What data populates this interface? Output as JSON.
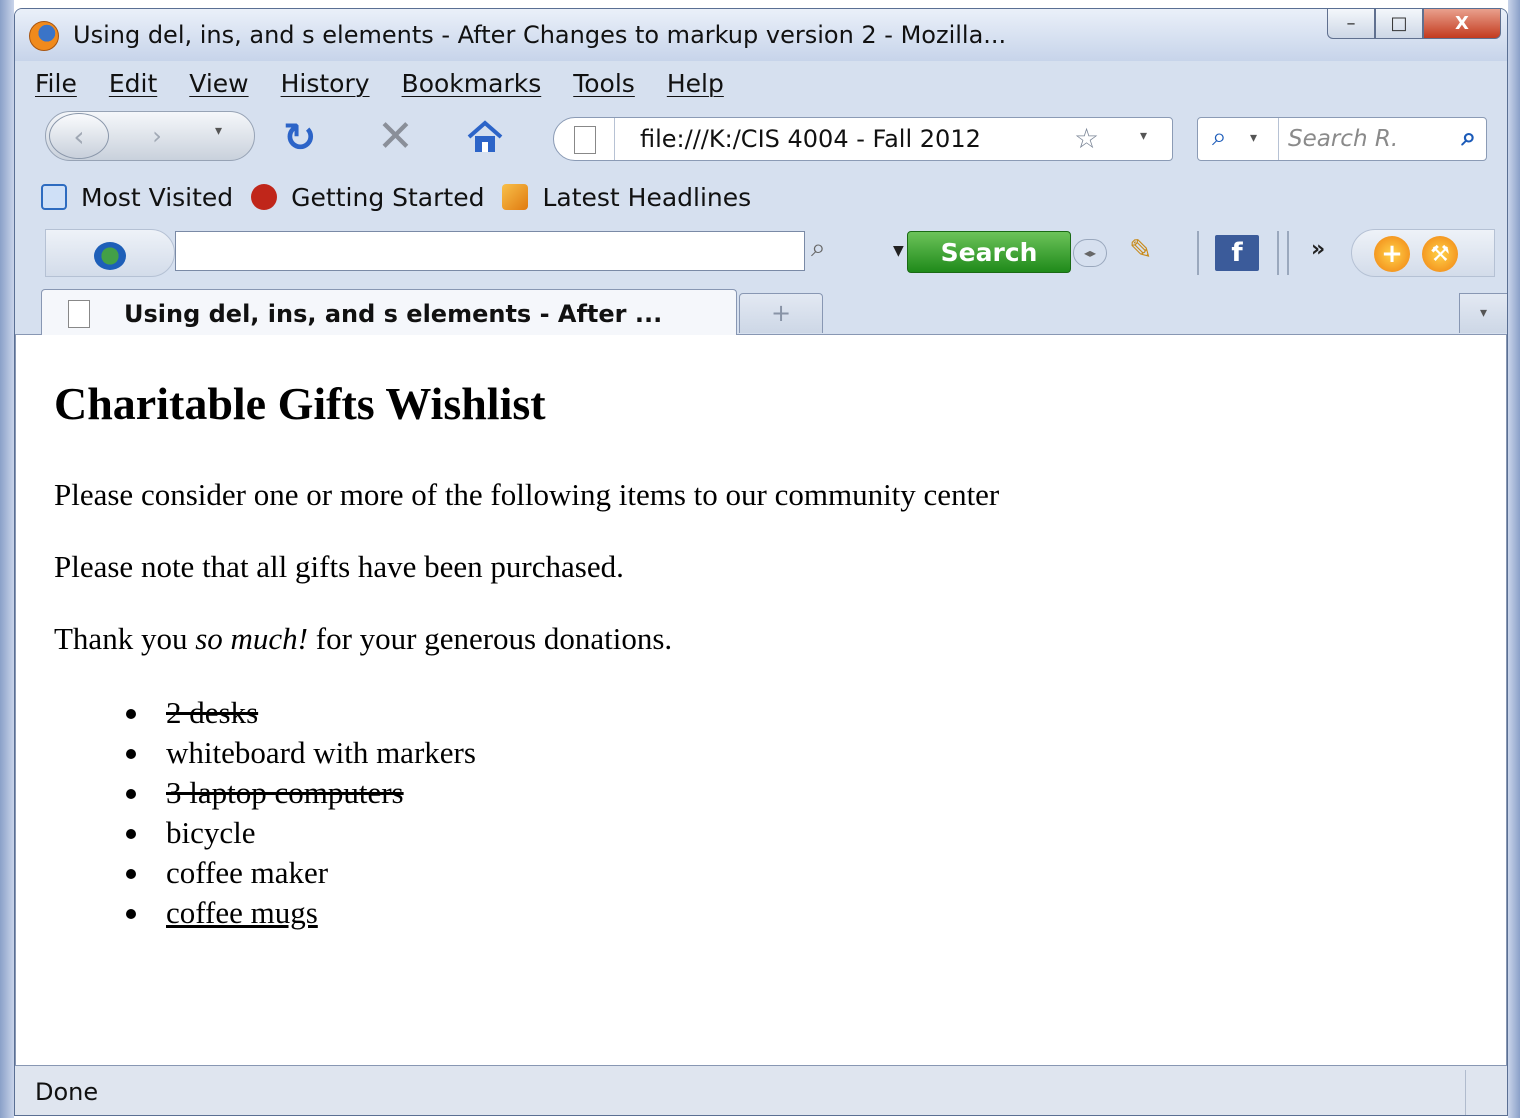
{
  "window": {
    "title": "Using del, ins, and s elements - After Changes to markup version 2 - Mozilla...",
    "min_glyph": "–",
    "max_glyph": "□",
    "close_glyph": "X"
  },
  "menu": [
    {
      "label": "File"
    },
    {
      "label": "Edit"
    },
    {
      "label": "View"
    },
    {
      "label": "History"
    },
    {
      "label": "Bookmarks"
    },
    {
      "label": "Tools"
    },
    {
      "label": "Help"
    }
  ],
  "nav": {
    "url": "file:///K:/CIS 4004 - Fall 2012",
    "search_placeholder": "Search R."
  },
  "bookmarks": [
    {
      "label": "Most Visited",
      "icon": "bookmark-folder-icon"
    },
    {
      "label": "Getting Started",
      "icon": "firefox-dino-icon"
    },
    {
      "label": "Latest Headlines",
      "icon": "rss-feed-icon"
    }
  ],
  "toolbar": {
    "search_button": "Search",
    "facebook_glyph": "f",
    "chevron": "»"
  },
  "tabs": [
    {
      "label": "Using del, ins, and s elements - After ..."
    }
  ],
  "page": {
    "heading": "Charitable Gifts Wishlist",
    "para1": "Please consider one or more of the following items to our community center",
    "para2": "Please note that all gifts have been purchased.",
    "para3_before": "Thank you ",
    "para3_em": "so much!",
    "para3_after": " for your generous donations.",
    "items": [
      {
        "text": "2 desks",
        "style": "deleted"
      },
      {
        "text": "whiteboard with markers",
        "style": "normal"
      },
      {
        "text": "3 laptop computers",
        "style": "deleted"
      },
      {
        "text": "bicycle",
        "style": "normal"
      },
      {
        "text": "coffee maker",
        "style": "normal"
      },
      {
        "text": "coffee mugs",
        "style": "inserted"
      }
    ]
  },
  "status": {
    "text": "Done"
  }
}
